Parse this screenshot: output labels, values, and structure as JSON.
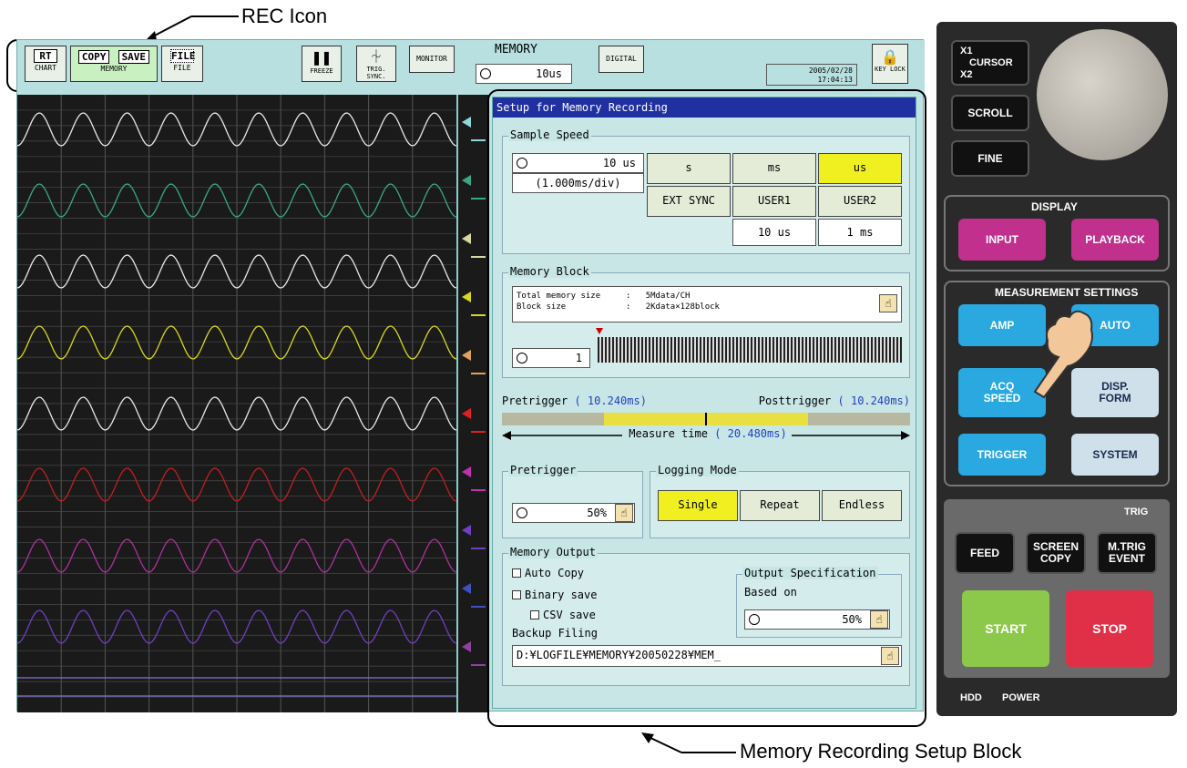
{
  "callouts": {
    "rec_icon": "REC Icon",
    "memory_setup_block": "Memory Recording Setup Block"
  },
  "topbar": {
    "rec_buttons": [
      {
        "icon": "RT",
        "label": "CHART"
      },
      {
        "icon": "COPY",
        "label": ""
      },
      {
        "icon": "SAVE",
        "label": ""
      },
      {
        "icon": "FILE",
        "label": "FILE"
      }
    ],
    "memory_label": "MEMORY",
    "freeze": "FREEZE",
    "trig_sync": "TRIG.\nSYNC.",
    "monitor": "MONITOR",
    "memory_title": "MEMORY",
    "memory_value": "10us",
    "digital": "DIGITAL",
    "date": "2005/02/28",
    "time": "17:04:13",
    "key_lock": "KEY LOCK"
  },
  "panel": {
    "title": "Setup for Memory Recording",
    "sample_speed": {
      "label": "Sample Speed",
      "value": "10 us",
      "per_div": "(1.000ms/div)",
      "units": [
        "s",
        "ms",
        "us"
      ],
      "selected_unit": "us",
      "ext_sync": "EXT SYNC",
      "user1": "USER1",
      "user2": "USER2",
      "user1_value": "10 us",
      "user2_value": "1 ms"
    },
    "memory_block": {
      "label": "Memory Block",
      "total_label": "Total memory size",
      "total_value": "5Mdata/CH",
      "block_label": "Block size",
      "block_value": "2Kdata×128block",
      "block_number": "1"
    },
    "trigger_bar": {
      "pretrigger_label": "Pretrigger",
      "pretrigger_value": "( 10.240ms)",
      "posttrigger_label": "Posttrigger",
      "posttrigger_value": "( 10.240ms)",
      "measure_label": "Measure time",
      "measure_value": "( 20.480ms)"
    },
    "pretrigger": {
      "label": "Pretrigger",
      "value": "50%"
    },
    "logging_mode": {
      "label": "Logging Mode",
      "options": [
        "Single",
        "Repeat",
        "Endless"
      ],
      "selected": "Single"
    },
    "memory_output": {
      "label": "Memory Output",
      "auto_copy": "Auto Copy",
      "binary_save": "Binary save",
      "csv_save": "CSV save",
      "backup_filing": "Backup Filing",
      "path": "D:¥LOGFILE¥MEMORY¥20050228¥MEM_",
      "output_spec_label": "Output Specification",
      "based_on": "Based on",
      "based_value": "50%"
    }
  },
  "hardware": {
    "x1": "X1",
    "cursor": "CURSOR",
    "x2": "X2",
    "scroll": "SCROLL",
    "fine": "FINE",
    "display": "DISPLAY",
    "input": "INPUT",
    "playback": "PLAYBACK",
    "measurement_settings": "MEASUREMENT SETTINGS",
    "amp": "AMP",
    "auto": "AUTO",
    "acq_speed": "ACQ\nSPEED",
    "disp_form": "DISP.\nFORM",
    "trigger": "TRIGGER",
    "system": "SYSTEM",
    "trig_led": "TRIG",
    "feed": "FEED",
    "screen_copy": "SCREEN\nCOPY",
    "mtrig_event": "M.TRIG\nEVENT",
    "start": "START",
    "stop": "STOP",
    "hdd": "HDD",
    "power": "POWER",
    "colors": {
      "input": "#c0308c",
      "playback": "#c0308c",
      "blue": "#2aa8e0",
      "light": "#cfe0ea",
      "start": "#8cc84a",
      "stop": "#e03048"
    }
  },
  "waves": {
    "colors": [
      "#e8e8e8",
      "#3aa888",
      "#e8e8e8",
      "#d8d820",
      "#e8e8e8",
      "#c02020",
      "#b030a0",
      "#7040c0"
    ]
  }
}
